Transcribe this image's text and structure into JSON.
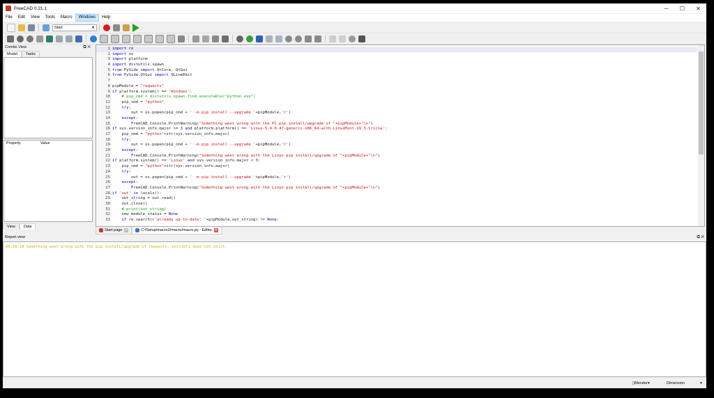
{
  "window": {
    "title": "FreeCAD 0.21.1",
    "controls": {
      "minimize": "─",
      "maximize": "☐",
      "close": "✕"
    }
  },
  "menu": [
    "File",
    "Edit",
    "View",
    "Tools",
    "Macro",
    "Windows",
    "Help"
  ],
  "toolbar": {
    "workbench": "Start"
  },
  "combo_view": {
    "title": "Combo View",
    "tabs": [
      "Model",
      "Tasks"
    ],
    "property_headers": [
      "Property",
      "Value"
    ],
    "bottom_tabs": [
      "View",
      "Data"
    ]
  },
  "editor": {
    "lines": [
      {
        "n": "1",
        "parts": [
          [
            "kw",
            "import"
          ],
          [
            "tx",
            " re"
          ]
        ]
      },
      {
        "n": "2",
        "parts": [
          [
            "kw",
            "import"
          ],
          [
            "tx",
            " os"
          ]
        ]
      },
      {
        "n": "3",
        "parts": [
          [
            "kw",
            "import"
          ],
          [
            "tx",
            " platform"
          ]
        ]
      },
      {
        "n": "4",
        "parts": [
          [
            "kw",
            "import"
          ],
          [
            "tx",
            " distutils.spawn"
          ]
        ]
      },
      {
        "n": "5",
        "parts": [
          [
            "kw",
            "from"
          ],
          [
            "tx",
            " PySide "
          ],
          [
            "kw",
            "import"
          ],
          [
            "tx",
            " QtCore, QtGui"
          ]
        ]
      },
      {
        "n": "6",
        "parts": [
          [
            "kw",
            "from"
          ],
          [
            "tx",
            " PySide.QtGui "
          ],
          [
            "kw",
            "import"
          ],
          [
            "tx",
            " QLineEdit"
          ]
        ]
      },
      {
        "n": "7",
        "parts": []
      },
      {
        "n": "8",
        "parts": [
          [
            "tx",
            "pipModule = "
          ],
          [
            "st",
            "\"requests\""
          ]
        ]
      },
      {
        "n": "9",
        "parts": [
          [
            "kw",
            "if"
          ],
          [
            "tx",
            " platform.system() == "
          ],
          [
            "st",
            "'Windows'"
          ],
          [
            "tx",
            ":"
          ]
        ]
      },
      {
        "n": "10",
        "parts": [
          [
            "cm",
            "    # pip_cmd = distutils.spawn.find_executable(\"python.exe\")"
          ]
        ]
      },
      {
        "n": "11",
        "parts": [
          [
            "tx",
            "    pip_cmd = "
          ],
          [
            "st",
            "\"python\""
          ]
        ]
      },
      {
        "n": "12",
        "parts": [
          [
            "kw",
            "    try"
          ],
          [
            "tx",
            ":"
          ]
        ]
      },
      {
        "n": "13",
        "parts": [
          [
            "tx",
            "        out = os.popen(pip_cmd + "
          ],
          [
            "st",
            "' -m pip install --upgrade '"
          ],
          [
            "tx",
            "+pipModule,"
          ],
          [
            "st",
            "'r'"
          ],
          [
            "tx",
            ")"
          ]
        ]
      },
      {
        "n": "14",
        "parts": [
          [
            "kw",
            "    except"
          ],
          [
            "tx",
            ":"
          ]
        ]
      },
      {
        "n": "15",
        "parts": [
          [
            "tx",
            "        FreeCAD.Console.PrintWarning("
          ],
          [
            "st",
            "\"Something went wrong with the PC pip install/upgrade of \"+pipModule+\"\\n\""
          ],
          [
            "tx",
            ")"
          ]
        ]
      },
      {
        "n": "16",
        "parts": [
          [
            "kw",
            "if"
          ],
          [
            "tx",
            " sys.version_info.major >= 3 "
          ],
          [
            "kw",
            "and"
          ],
          [
            "tx",
            " platform.platform() == "
          ],
          [
            "st",
            "'Linux-5.4.0-47-generic-x86_64-with-LinuxMint-19.3-tricia'"
          ],
          [
            "tx",
            ":"
          ]
        ]
      },
      {
        "n": "17",
        "parts": [
          [
            "tx",
            "    pip_cmd = "
          ],
          [
            "st",
            "\"python\""
          ],
          [
            "tx",
            "+str(sys.version_info.major)"
          ]
        ]
      },
      {
        "n": "18",
        "parts": [
          [
            "kw",
            "    try"
          ],
          [
            "tx",
            ":"
          ]
        ]
      },
      {
        "n": "19",
        "parts": [
          [
            "tx",
            "        out = os.popen(pip_cmd + "
          ],
          [
            "st",
            "' -m pip install --upgrade '"
          ],
          [
            "tx",
            "+pipModule,"
          ],
          [
            "st",
            "'r'"
          ],
          [
            "tx",
            ")"
          ]
        ]
      },
      {
        "n": "20",
        "parts": [
          [
            "kw",
            "    except"
          ],
          [
            "tx",
            ":"
          ]
        ]
      },
      {
        "n": "21",
        "parts": [
          [
            "tx",
            "        FreeCAD.Console.PrintWarning("
          ],
          [
            "st",
            "\"Something went wrong with the Linux pip install/upgrade of \"+pipModule+\"\\n\""
          ],
          [
            "tx",
            ")"
          ]
        ]
      },
      {
        "n": "22",
        "parts": [
          [
            "kw",
            "if"
          ],
          [
            "tx",
            " platform.system() == "
          ],
          [
            "st",
            "'Linux'"
          ],
          [
            "kw",
            " and"
          ],
          [
            "tx",
            " sys.version_info.major < 3:"
          ]
        ]
      },
      {
        "n": "23",
        "parts": [
          [
            "tx",
            "    pip_cmd = "
          ],
          [
            "st",
            "\"python\""
          ],
          [
            "tx",
            "+str(sys.version_info.major)"
          ]
        ]
      },
      {
        "n": "24",
        "parts": [
          [
            "kw",
            "    try"
          ],
          [
            "tx",
            ":"
          ]
        ]
      },
      {
        "n": "25",
        "parts": [
          [
            "tx",
            "        out = os.popen(pip_cmd + "
          ],
          [
            "st",
            "' -m pip install --upgrade '"
          ],
          [
            "tx",
            "+pipModule,"
          ],
          [
            "st",
            "'r'"
          ],
          [
            "tx",
            ")"
          ]
        ]
      },
      {
        "n": "26",
        "parts": [
          [
            "kw",
            "    except"
          ],
          [
            "tx",
            ":"
          ]
        ]
      },
      {
        "n": "27",
        "parts": [
          [
            "tx",
            "        FreeCAD.Console.PrintWarning("
          ],
          [
            "st",
            "\"Something went wrong with the Linux pip install/upgrade of \"+pipModule+\"\\n\""
          ],
          [
            "tx",
            ")"
          ]
        ]
      },
      {
        "n": "28",
        "parts": [
          [
            "kw",
            "if"
          ],
          [
            "st",
            " 'out'"
          ],
          [
            "kw",
            " in"
          ],
          [
            "tx",
            " locals():"
          ]
        ]
      },
      {
        "n": "29",
        "parts": [
          [
            "tx",
            "    out_string = out.read()"
          ]
        ]
      },
      {
        "n": "30",
        "parts": [
          [
            "tx",
            "    out.close()"
          ]
        ]
      },
      {
        "n": "31",
        "parts": [
          [
            "cm",
            "    # print(out_string)"
          ]
        ]
      },
      {
        "n": "32",
        "parts": [
          [
            "tx",
            "    new_module_status = "
          ],
          [
            "kw",
            "None"
          ]
        ]
      },
      {
        "n": "33",
        "parts": [
          [
            "kw",
            "    if"
          ],
          [
            "tx",
            " re.search(r"
          ],
          [
            "st",
            "'already up-to-date: '"
          ],
          [
            "tx",
            "+pipModule,out_string) != "
          ],
          [
            "kw",
            "None"
          ],
          [
            "tx",
            ":"
          ]
        ]
      }
    ]
  },
  "doc_tabs": [
    {
      "label": "Start page",
      "close": "✕"
    },
    {
      "label": "C:/Setup/macro2/macro/macro.py - Editor",
      "close": "✕"
    }
  ],
  "report": {
    "title": "Report view",
    "message": "08:58:18  Something went wrong with the pip install/upgrade of requests, possibly does not exist."
  },
  "status": {
    "navigation": "Blender",
    "units": "Dimension"
  }
}
